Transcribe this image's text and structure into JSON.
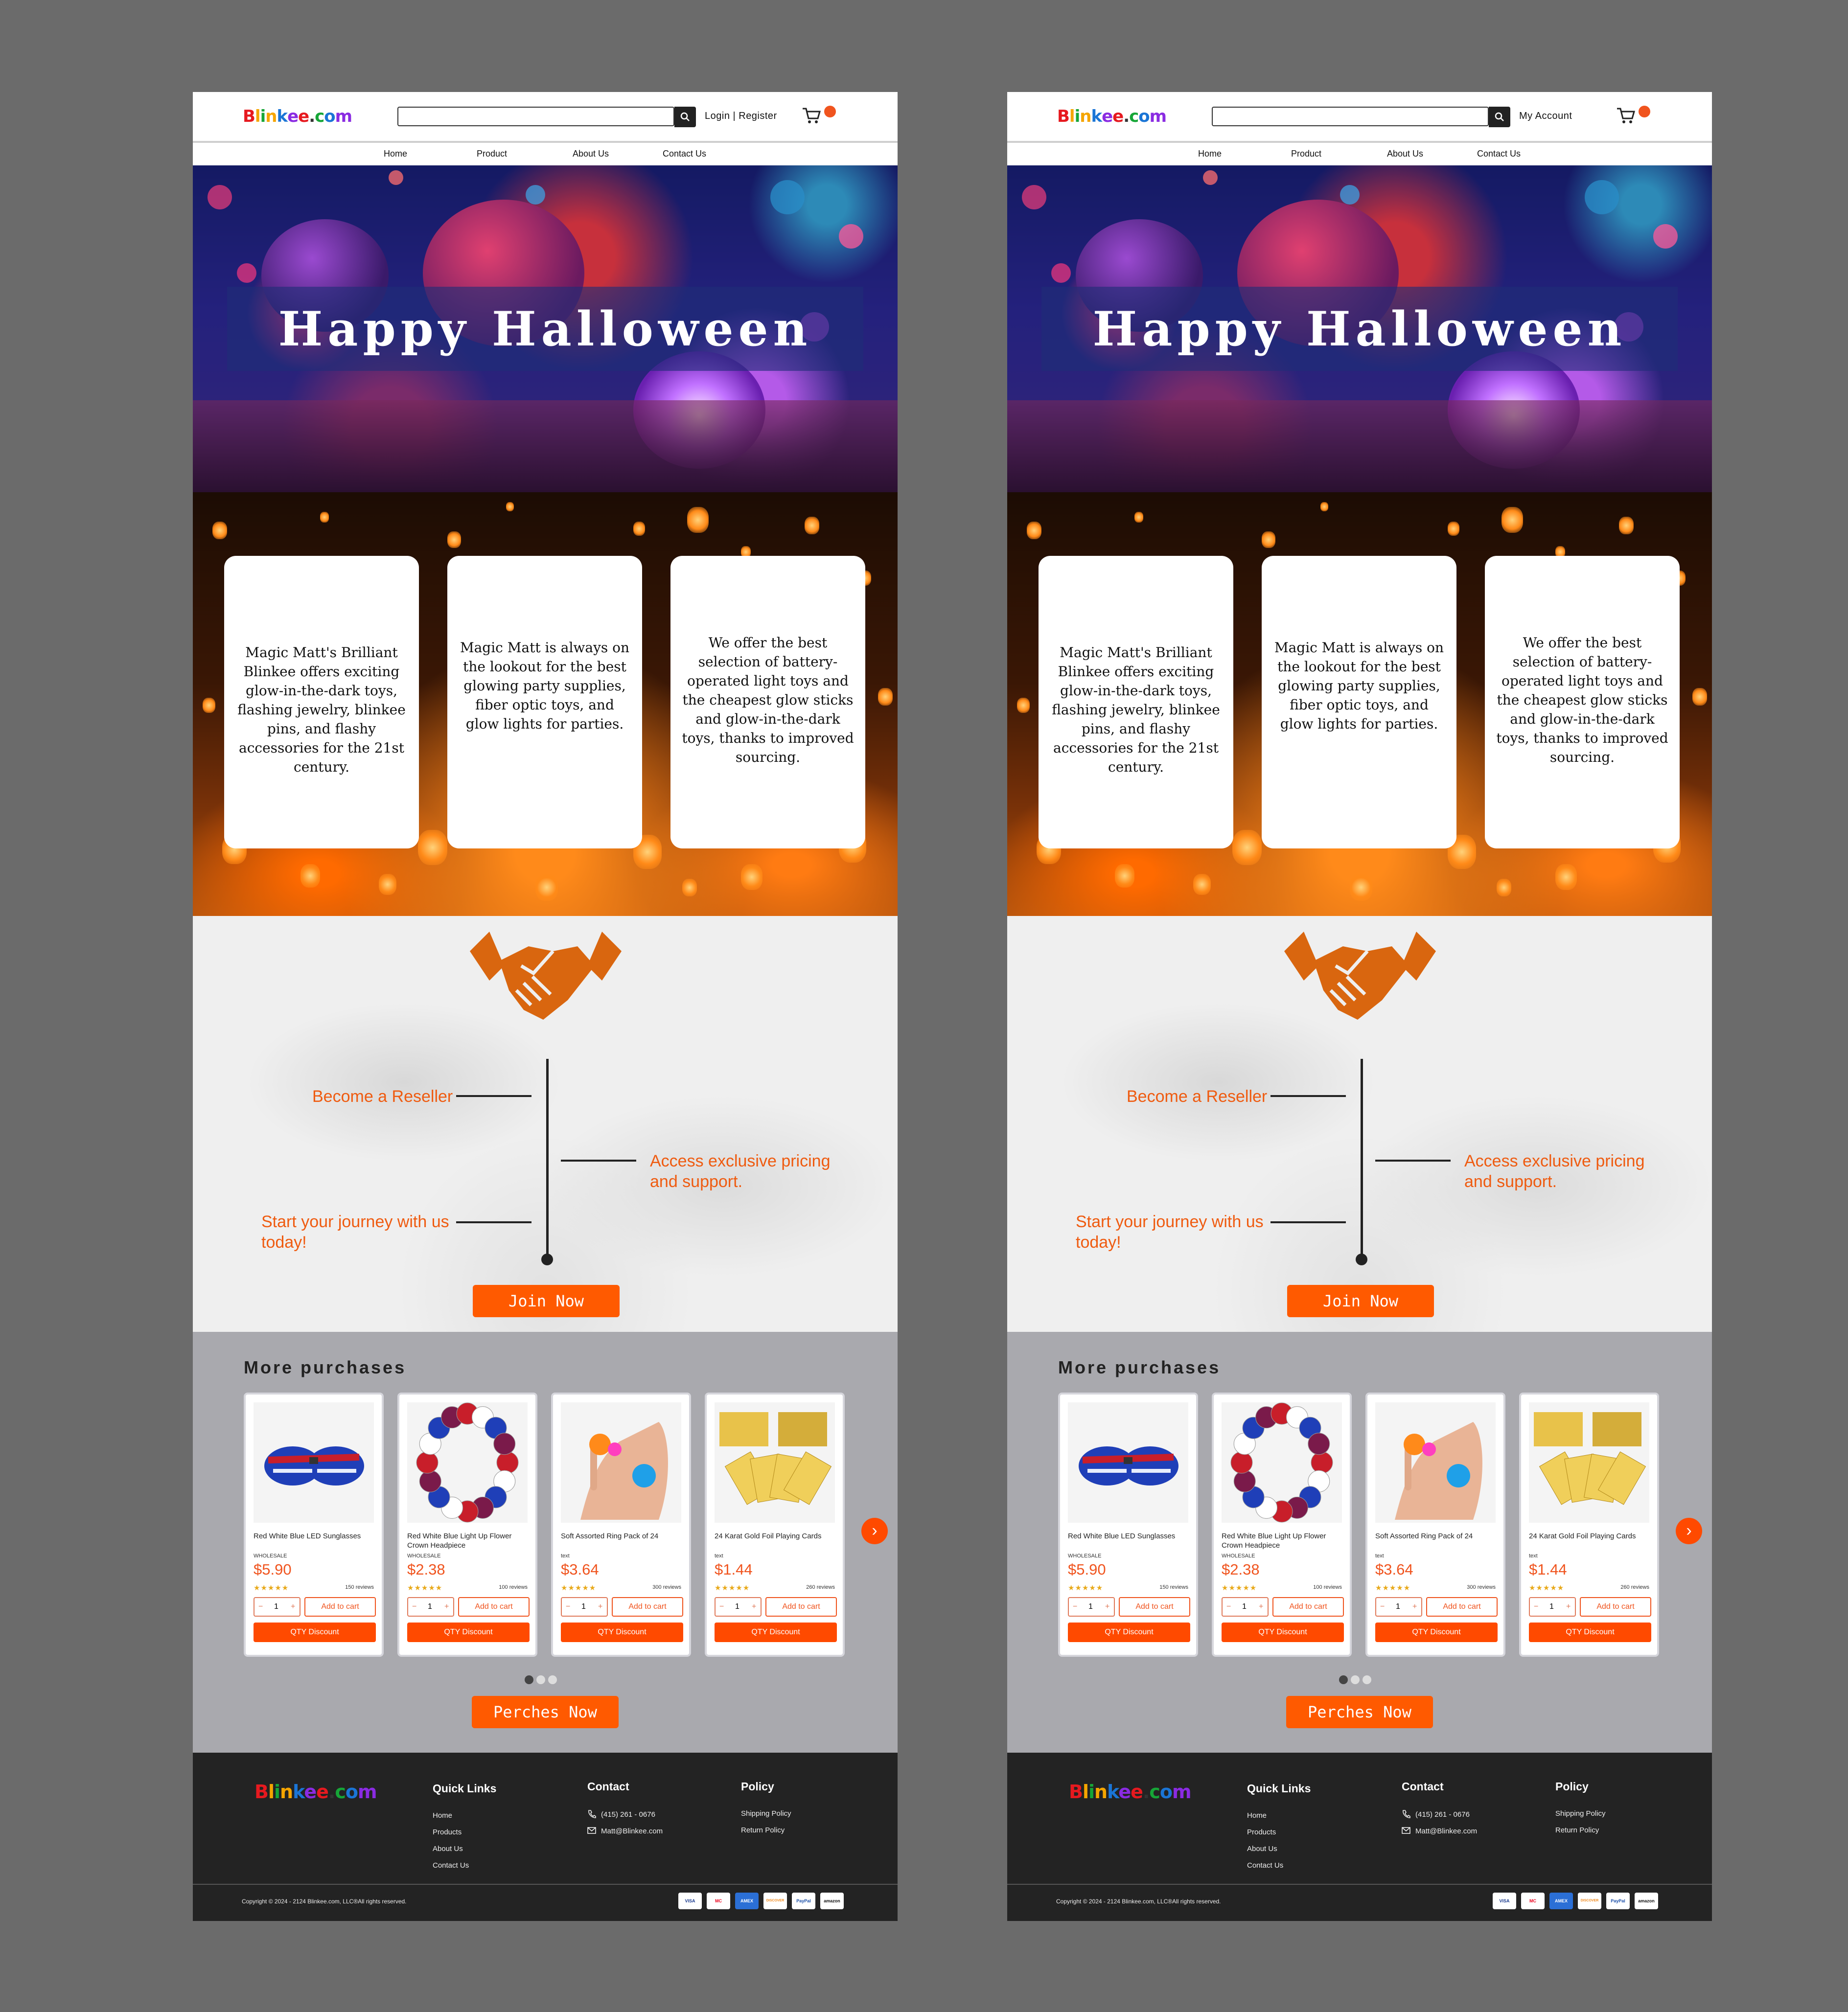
{
  "colors": {
    "accent": "#ff5a00",
    "footer_bg": "#232323",
    "products_bg": "#a9a9ae",
    "reseller_text": "#ef5b10"
  },
  "brand": {
    "logo_letters": [
      "B",
      "l",
      "i",
      "n",
      "k",
      "e",
      "e",
      ".",
      "c",
      "o",
      "m"
    ],
    "logo_colors": [
      "#e6191f",
      "#f5a500",
      "#16a637",
      "#f5a500",
      "#1a75d6",
      "#8a2be2",
      "#e6191f",
      "#333",
      "#16a637",
      "#1a75d6",
      "#8a2be2"
    ]
  },
  "pages": [
    {
      "header": {
        "account_label": "Login | Register",
        "search_placeholder": ""
      },
      "nav": [
        "Home",
        "Product",
        "About Us",
        "Contact Us"
      ],
      "hero": {
        "title": "Happy Halloween"
      },
      "cards": [
        "Magic Matt's Brilliant Blinkee offers exciting glow-in-the-dark toys, flashing jewelry, blinkee pins, and flashy accessories for the 21st century.",
        "Magic Matt is always on the lookout for the best glowing party supplies, fiber optic toys, and glow lights for parties.",
        "We offer the best selection of battery-operated light toys and the cheapest glow sticks and glow-in-the-dark toys, thanks to improved sourcing."
      ],
      "reseller": {
        "point1": "Become a Reseller",
        "point2": "Access exclusive pricing and support.",
        "point3": "Start your journey with us today!",
        "button": "Join Now"
      },
      "products": {
        "title": "More purchases",
        "items": [
          {
            "name": "Red White Blue LED Sunglasses",
            "tag": "WHOLESALE",
            "price": "$5.90",
            "reviews": "150 reviews",
            "qty": "1",
            "add": "Add to cart",
            "discount": "QTY Discount"
          },
          {
            "name": "Red White Blue Light Up Flower Crown Headpiece",
            "tag": "WHOLESALE",
            "price": "$2.38",
            "reviews": "100 reviews",
            "qty": "1",
            "add": "Add to cart",
            "discount": "QTY Discount"
          },
          {
            "name": "Soft Assorted Ring Pack of 24",
            "tag": "text",
            "price": "$3.64",
            "reviews": "300 reviews",
            "qty": "1",
            "add": "Add to cart",
            "discount": "QTY Discount"
          },
          {
            "name": "24 Karat Gold Foil Playing Cards",
            "tag": "text",
            "price": "$1.44",
            "reviews": "260 reviews",
            "qty": "1",
            "add": "Add to cart",
            "discount": "QTY Discount"
          }
        ],
        "button": "Perches Now"
      },
      "footer": {
        "quick_links_title": "Quick Links",
        "quick_links": [
          "Home",
          "Products",
          "About Us",
          "Contact Us"
        ],
        "contact_title": "Contact",
        "phone": "(415) 261 - 0676",
        "email": "Matt@Blinkee.com",
        "policy_title": "Policy",
        "policy_links": [
          "Shipping Policy",
          "Return Policy"
        ],
        "copyright": "Copyright © 2024 - 2124 Blinkee.com, LLC®All rights reserved.",
        "payments": [
          "VISA",
          "MC",
          "AMEX",
          "DISCOVER",
          "PayPal",
          "amazon"
        ]
      }
    },
    {
      "header": {
        "account_label": "My Account",
        "search_placeholder": ""
      },
      "nav": [
        "Home",
        "Product",
        "About Us",
        "Contact Us"
      ],
      "hero": {
        "title": "Happy Halloween"
      },
      "cards": [
        "Magic Matt's Brilliant Blinkee offers exciting glow-in-the-dark toys, flashing jewelry, blinkee pins, and flashy accessories for the 21st century.",
        "Magic Matt is always on the lookout for the best glowing party supplies, fiber optic toys, and glow lights for parties.",
        "We offer the best selection of battery-operated light toys and the cheapest glow sticks and glow-in-the-dark toys, thanks to improved sourcing."
      ],
      "reseller": {
        "point1": "Become a Reseller",
        "point2": "Access exclusive pricing and support.",
        "point3": "Start your journey with us today!",
        "button": "Join Now"
      },
      "products": {
        "title": "More purchases",
        "items": [
          {
            "name": "Red White Blue LED Sunglasses",
            "tag": "WHOLESALE",
            "price": "$5.90",
            "reviews": "150 reviews",
            "qty": "1",
            "add": "Add to cart",
            "discount": "QTY Discount"
          },
          {
            "name": "Red White Blue Light Up Flower Crown Headpiece",
            "tag": "WHOLESALE",
            "price": "$2.38",
            "reviews": "100 reviews",
            "qty": "1",
            "add": "Add to cart",
            "discount": "QTY Discount"
          },
          {
            "name": "Soft Assorted Ring Pack of 24",
            "tag": "text",
            "price": "$3.64",
            "reviews": "300 reviews",
            "qty": "1",
            "add": "Add to cart",
            "discount": "QTY Discount"
          },
          {
            "name": "24 Karat Gold Foil Playing Cards",
            "tag": "text",
            "price": "$1.44",
            "reviews": "260 reviews",
            "qty": "1",
            "add": "Add to cart",
            "discount": "QTY Discount"
          }
        ],
        "button": "Perches Now"
      },
      "footer": {
        "quick_links_title": "Quick Links",
        "quick_links": [
          "Home",
          "Products",
          "About Us",
          "Contact Us"
        ],
        "contact_title": "Contact",
        "phone": "(415) 261 - 0676",
        "email": "Matt@Blinkee.com",
        "policy_title": "Policy",
        "policy_links": [
          "Shipping Policy",
          "Return Policy"
        ],
        "copyright": "Copyright © 2024 - 2124 Blinkee.com, LLC®All rights reserved.",
        "payments": [
          "VISA",
          "MC",
          "AMEX",
          "DISCOVER",
          "PayPal",
          "amazon"
        ]
      }
    }
  ]
}
